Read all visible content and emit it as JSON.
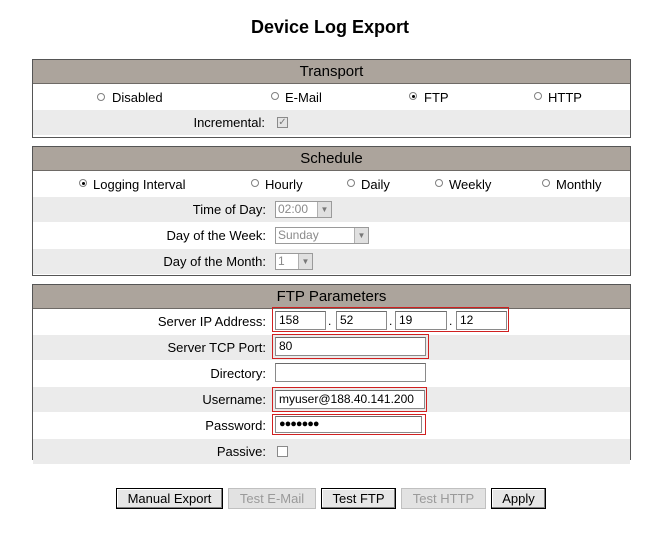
{
  "page": {
    "title": "Device Log Export"
  },
  "transport": {
    "header": "Transport",
    "options": [
      {
        "label": "Disabled",
        "selected": false
      },
      {
        "label": "E-Mail",
        "selected": false
      },
      {
        "label": "FTP",
        "selected": true
      },
      {
        "label": "HTTP",
        "selected": false
      }
    ],
    "incremental_label": "Incremental:",
    "incremental_checked": true
  },
  "schedule": {
    "header": "Schedule",
    "options": [
      {
        "label": "Logging Interval",
        "selected": true
      },
      {
        "label": "Hourly",
        "selected": false
      },
      {
        "label": "Daily",
        "selected": false
      },
      {
        "label": "Weekly",
        "selected": false
      },
      {
        "label": "Monthly",
        "selected": false
      }
    ],
    "time_of_day_label": "Time of Day:",
    "time_of_day_value": "02:00",
    "day_of_week_label": "Day of the Week:",
    "day_of_week_value": "Sunday",
    "day_of_month_label": "Day of the Month:",
    "day_of_month_value": "1"
  },
  "ftp": {
    "header": "FTP Parameters",
    "server_ip_label": "Server IP Address:",
    "ip": [
      "158",
      "52",
      "19",
      "12"
    ],
    "tcp_port_label": "Server TCP Port:",
    "tcp_port_value": "80",
    "directory_label": "Directory:",
    "directory_value": "",
    "username_label": "Username:",
    "username_value": "myuser@188.40.141.200",
    "password_label": "Password:",
    "password_value": "●●●●●●●",
    "passive_label": "Passive:",
    "passive_checked": false
  },
  "buttons": {
    "manual_export": "Manual Export",
    "test_email": "Test E-Mail",
    "test_ftp": "Test FTP",
    "test_http": "Test HTTP",
    "apply": "Apply"
  },
  "colors": {
    "panel_header": "#aca49c",
    "row_gray": "#ebebeb",
    "highlight": "#d02020"
  }
}
